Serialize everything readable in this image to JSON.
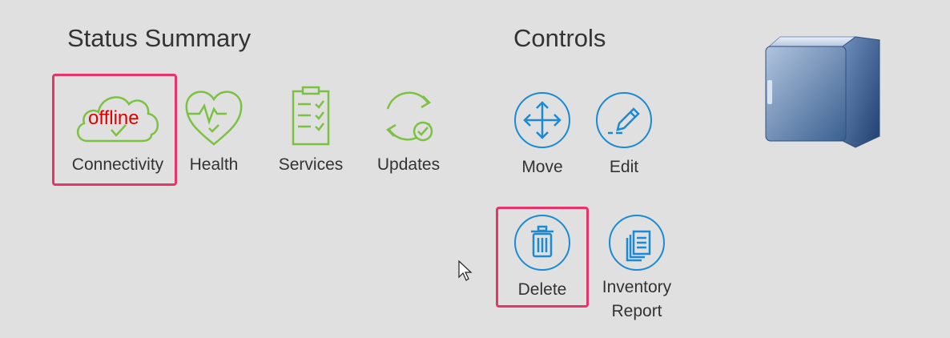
{
  "status_summary": {
    "title": "Status Summary",
    "items": [
      {
        "label": "Connectivity",
        "icon": "cloud-icon",
        "overlay": "offline"
      },
      {
        "label": "Health",
        "icon": "heart-pulse-icon"
      },
      {
        "label": "Services",
        "icon": "clipboard-checklist-icon"
      },
      {
        "label": "Updates",
        "icon": "refresh-check-icon"
      }
    ]
  },
  "controls": {
    "title": "Controls",
    "items": [
      {
        "label": "Move",
        "icon": "move-arrows-icon"
      },
      {
        "label": "Edit",
        "icon": "pencil-icon"
      },
      {
        "label": "Delete",
        "icon": "trash-icon"
      },
      {
        "label": "Inventory Report",
        "icon": "documents-icon"
      }
    ]
  },
  "device_icon": "server-cube-icon",
  "colors": {
    "status_green": "#7cc242",
    "control_blue": "#1a8ad4",
    "highlight": "#e8336b",
    "offline_text": "#e00000",
    "background": "#e0e0e0"
  }
}
